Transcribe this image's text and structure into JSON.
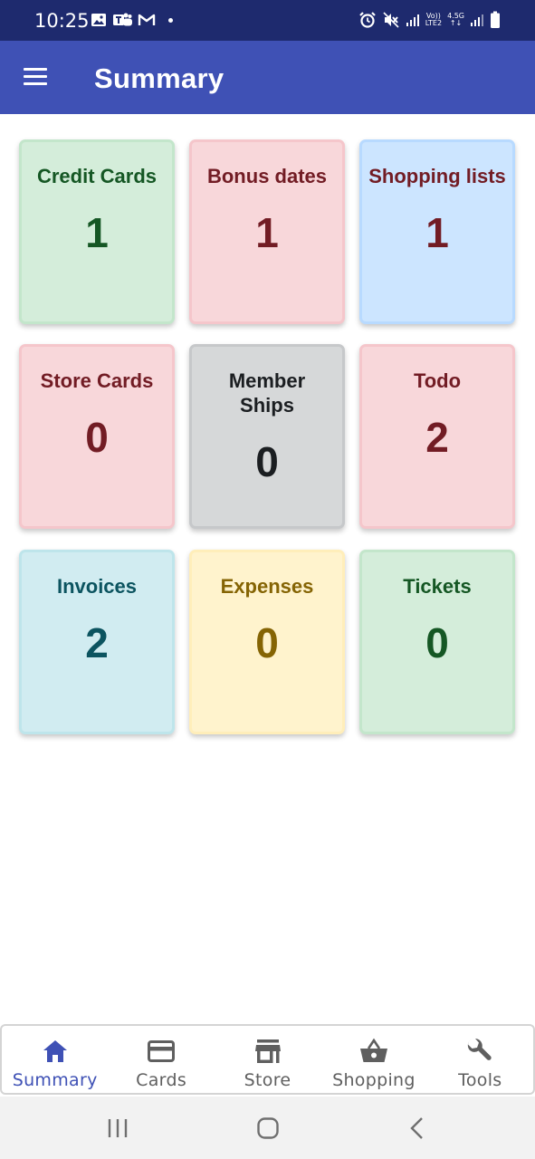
{
  "status_bar": {
    "time": "10:25",
    "network_label_top": "Vo))",
    "network_label_bottom": "LTE2",
    "speed_label": "4.5G",
    "icons": [
      "gallery-icon",
      "teams-icon",
      "gmail-icon",
      "alarm-icon",
      "mute-icon",
      "signal-icon",
      "battery-icon"
    ]
  },
  "app_bar": {
    "title": "Summary",
    "menu_icon": "menu-icon",
    "color": "#3f51b5"
  },
  "tiles": [
    {
      "label": "Credit Cards",
      "count": "1",
      "bg": "#d4edda",
      "border": "#c3e6cb",
      "text": "#155724"
    },
    {
      "label": "Bonus dates",
      "count": "1",
      "bg": "#f8d7da",
      "border": "#f5c6cb",
      "text": "#721c24"
    },
    {
      "label": "Shopping lists",
      "count": "1",
      "bg": "#cce5ff",
      "border": "#b8daff",
      "text": "#721c24"
    },
    {
      "label": "Store Cards",
      "count": "0",
      "bg": "#f8d7da",
      "border": "#f5c6cb",
      "text": "#721c24"
    },
    {
      "label": "Member Ships",
      "count": "0",
      "bg": "#d6d8d9",
      "border": "#c6c8ca",
      "text": "#1b1e21"
    },
    {
      "label": "Todo",
      "count": "2",
      "bg": "#f8d7da",
      "border": "#f5c6cb",
      "text": "#721c24"
    },
    {
      "label": "Invoices",
      "count": "2",
      "bg": "#d1ecf1",
      "border": "#bee5eb",
      "text": "#0c5460"
    },
    {
      "label": "Expenses",
      "count": "0",
      "bg": "#fff3cd",
      "border": "#ffeeba",
      "text": "#856404"
    },
    {
      "label": "Tickets",
      "count": "0",
      "bg": "#d4edda",
      "border": "#c3e6cb",
      "text": "#155724"
    }
  ],
  "bottom_nav": {
    "items": [
      {
        "label": "Summary",
        "icon": "home-icon",
        "active": true
      },
      {
        "label": "Cards",
        "icon": "credit-card-icon",
        "active": false
      },
      {
        "label": "Store",
        "icon": "store-icon",
        "active": false
      },
      {
        "label": "Shopping",
        "icon": "shopping-basket-icon",
        "active": false
      },
      {
        "label": "Tools",
        "icon": "wrench-icon",
        "active": false
      }
    ],
    "active_color": "#3f51b5",
    "inactive_color": "#5f5f5f"
  },
  "system_nav": {
    "icons": [
      "recent-apps-icon",
      "home-button-icon",
      "back-icon"
    ]
  }
}
